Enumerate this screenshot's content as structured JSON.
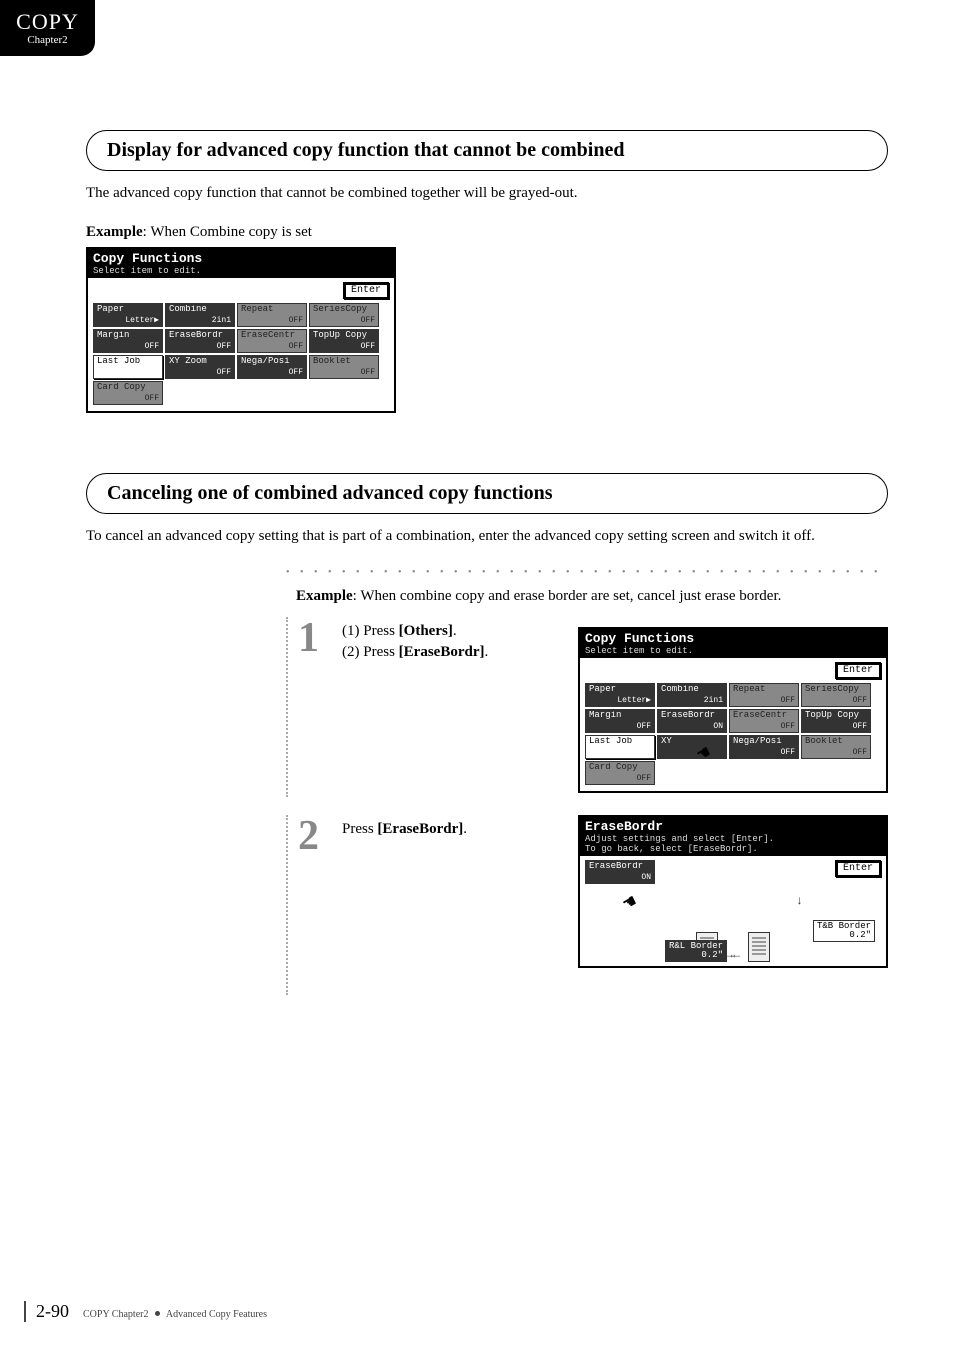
{
  "corner": {
    "big": "COPY",
    "small": "Chapter2"
  },
  "section1": {
    "heading": "Display for advanced copy function that cannot be combined",
    "body": "The advanced copy function that cannot be combined together will be grayed-out.",
    "example_label_b": "Example",
    "example_label_rest": ": When Combine copy is set"
  },
  "lcd1": {
    "title": "Copy Functions",
    "sub": "Select item to edit.",
    "enter": "Enter",
    "cells": [
      [
        {
          "t": "Paper",
          "b": "Letter▶",
          "cls": "dark"
        },
        {
          "t": "Combine",
          "b": "2in1",
          "cls": "dark"
        },
        {
          "t": "Repeat",
          "b": "OFF",
          "cls": "gray"
        },
        {
          "t": "SeriesCopy",
          "b": "OFF",
          "cls": "gray"
        }
      ],
      [
        {
          "t": "Margin",
          "b": "OFF",
          "cls": "dark"
        },
        {
          "t": "EraseBordr",
          "b": "OFF",
          "cls": "dark"
        },
        {
          "t": "EraseCentr",
          "b": "OFF",
          "cls": "gray"
        },
        {
          "t": "TopUp Copy",
          "b": "OFF",
          "cls": "dark"
        }
      ],
      [
        {
          "t": "Last Job",
          "b": "",
          "cls": "white shadow"
        },
        {
          "t": "XY Zoom",
          "b": "OFF",
          "cls": "dark"
        },
        {
          "t": "Nega/Posi",
          "b": "OFF",
          "cls": "dark"
        },
        {
          "t": "Booklet",
          "b": "OFF",
          "cls": "gray"
        }
      ],
      [
        {
          "t": "Card Copy",
          "b": "OFF",
          "cls": "gray"
        },
        {
          "t": "",
          "b": "",
          "cls": "empty"
        },
        {
          "t": "",
          "b": "",
          "cls": "empty"
        },
        {
          "t": "",
          "b": "",
          "cls": "empty"
        }
      ]
    ]
  },
  "section2": {
    "heading": "Canceling one of combined advanced copy functions",
    "body": "To cancel an advanced copy setting that is part of a combination, enter the advanced copy setting screen and switch it off.",
    "example_b": "Example",
    "example_rest": ": When combine copy and erase border are set, cancel just erase border."
  },
  "step1": {
    "num": "1",
    "line1a": "(1) Press ",
    "line1b": "[Others]",
    "line1c": ".",
    "line2a": "(2) Press ",
    "line2b": "[EraseBordr]",
    "line2c": "."
  },
  "lcd2": {
    "title": "Copy Functions",
    "sub": "Select item to edit.",
    "enter": "Enter",
    "cells": [
      [
        {
          "t": "Paper",
          "b": "Letter▶",
          "cls": "dark"
        },
        {
          "t": "Combine",
          "b": "2in1",
          "cls": "dark"
        },
        {
          "t": "Repeat",
          "b": "OFF",
          "cls": "gray"
        },
        {
          "t": "SeriesCopy",
          "b": "OFF",
          "cls": "gray"
        }
      ],
      [
        {
          "t": "Margin",
          "b": "OFF",
          "cls": "dark"
        },
        {
          "t": "EraseBordr",
          "b": "ON",
          "cls": "dark"
        },
        {
          "t": "EraseCentr",
          "b": "OFF",
          "cls": "gray"
        },
        {
          "t": "TopUp Copy",
          "b": "OFF",
          "cls": "dark"
        }
      ],
      [
        {
          "t": "Last Job",
          "b": "",
          "cls": "white shadow"
        },
        {
          "t": "XY",
          "b": "",
          "cls": "dark"
        },
        {
          "t": "Nega/Posi",
          "b": "OFF",
          "cls": "dark"
        },
        {
          "t": "Booklet",
          "b": "OFF",
          "cls": "gray"
        }
      ],
      [
        {
          "t": "Card Copy",
          "b": "OFF",
          "cls": "gray"
        },
        {
          "t": "",
          "b": "",
          "cls": "empty"
        },
        {
          "t": "",
          "b": "",
          "cls": "empty"
        },
        {
          "t": "",
          "b": "",
          "cls": "empty"
        }
      ]
    ]
  },
  "step2": {
    "num": "2",
    "line_a": "Press ",
    "line_b": "[EraseBordr]",
    "line_c": "."
  },
  "lcd3": {
    "title": "EraseBordr",
    "sub1": "Adjust settings and select [Enter].",
    "sub2": "To go back, select [EraseBordr].",
    "enter": "Enter",
    "eb_cell_t": "EraseBordr",
    "eb_cell_b": "ON",
    "tb_t": "T&B Border",
    "tb_b": "0.2\"",
    "rl_t": "R&L Border",
    "rl_b": "0.2\""
  },
  "footer": {
    "page": "2-90",
    "chapter": "COPY Chapter2",
    "section": "Advanced Copy Features"
  }
}
